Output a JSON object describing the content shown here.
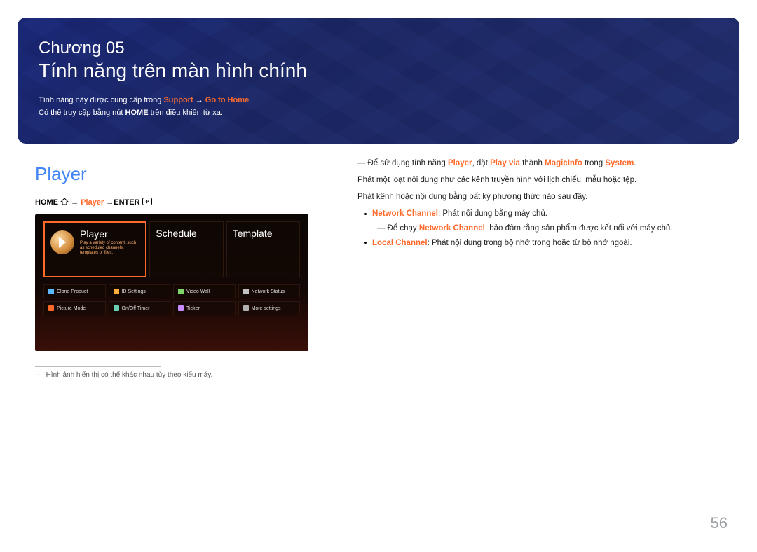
{
  "hero": {
    "chapter": "Chương 05",
    "title": "Tính năng trên màn hình chính",
    "line1_a": "Tính năng này được cung cấp trong ",
    "line1_support": "Support",
    "line1_arrow": " → ",
    "line1_goto": "Go to Home",
    "line1_end": ".",
    "line2_a": "Có thể truy cập bằng nút ",
    "line2_home": "HOME",
    "line2_b": " trên điều khiển từ xa."
  },
  "left": {
    "section_title": "Player",
    "bc_home": "HOME ",
    "bc_arrow1": " → ",
    "bc_player": "Player",
    "bc_arrow2": " →",
    "bc_enter": "ENTER ",
    "tv": {
      "tile1_title": "Player",
      "tile1_sub": "Play a variety of content, such as scheduled channels, templates or files.",
      "tile2": "Schedule",
      "tile3": "Template",
      "mini": [
        {
          "label": "Clone Product",
          "color": "#5db9ff"
        },
        {
          "label": "ID Settings",
          "color": "#ffae3a"
        },
        {
          "label": "Video Wall",
          "color": "#7fd46c"
        },
        {
          "label": "Network Status",
          "color": "#c0c0c0"
        },
        {
          "label": "Picture Mode",
          "color": "#ff6a2b"
        },
        {
          "label": "On/Off Timer",
          "color": "#6ad0b4"
        },
        {
          "label": "Ticker",
          "color": "#c98cff"
        },
        {
          "label": "More settings",
          "color": "#b0b0b0"
        }
      ]
    },
    "footnote": "Hình ảnh hiển thị có thể khác nhau tùy theo kiểu máy."
  },
  "right": {
    "p1_a": "Để sử dụng tính năng ",
    "p1_player": "Player",
    "p1_b": ", đặt ",
    "p1_playvia": "Play via",
    "p1_c": " thành ",
    "p1_magic": "MagicInfo",
    "p1_d": " trong ",
    "p1_system": "System",
    "p1_e": ".",
    "p2": "Phát một loạt nội dung như các kênh truyền hình với lịch chiếu, mẫu hoặc tệp.",
    "p3": "Phát kênh hoặc nội dung bằng bất kỳ phương thức nào sau đây.",
    "b1_label": "Network Channel",
    "b1_text": ": Phát nội dung bằng máy chủ.",
    "b1_sub_a": "Để chạy ",
    "b1_sub_label": "Network Channel",
    "b1_sub_b": ", bảo đảm rằng sản phẩm được kết nối với máy chủ.",
    "b2_label": "Local Channel",
    "b2_text": ": Phát nội dung trong bộ nhớ trong hoặc từ bộ nhớ ngoài."
  },
  "page_number": "56"
}
